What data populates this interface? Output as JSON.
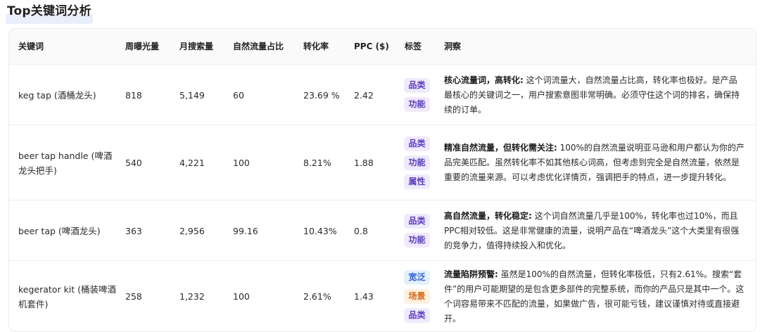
{
  "title": "Top关键词分析",
  "columns": {
    "keyword": "关键词",
    "impressions": "周曝光量",
    "searches": "月搜索量",
    "organic": "自然流量占比",
    "cvr": "转化率",
    "ppc": "PPC ($)",
    "tags": "标签",
    "insight": "洞察"
  },
  "colors": {
    "tag_purple_bg": "#efeafe",
    "tag_purple_fg": "#5b3cc4",
    "tag_blue_bg": "#e5efff",
    "tag_blue_fg": "#2b63d9",
    "tag_orange_bg": "#fff0e0",
    "tag_orange_fg": "#d6670f"
  },
  "rows": [
    {
      "keyword": "keg tap (酒桶龙头)",
      "impressions": "818",
      "searches": "5,149",
      "organic": "60",
      "cvr": "23.69 %",
      "ppc": "2.42",
      "tags": [
        {
          "label": "品类",
          "color": "purple"
        },
        {
          "label": "功能",
          "color": "purple"
        }
      ],
      "insight_head": "核心流量词，高转化:",
      "insight_body": " 这个词流量大，自然流量占比高，转化率也极好。是产品最核心的关键词之一，用户搜索意图非常明确。必须守住这个词的排名，确保持续的订单。"
    },
    {
      "keyword": "beer tap handle (啤酒龙头把手)",
      "impressions": "540",
      "searches": "4,221",
      "organic": "100",
      "cvr": "8.21%",
      "ppc": "1.88",
      "tags": [
        {
          "label": "品类",
          "color": "purple"
        },
        {
          "label": "功能",
          "color": "purple"
        },
        {
          "label": "属性",
          "color": "purple"
        }
      ],
      "insight_head": "精准自然流量，但转化需关注:",
      "insight_body": " 100%的自然流量说明亚马逊和用户都认为你的产品完美匹配。虽然转化率不如其他核心词高，但考虑到完全是自然流量，依然是重要的流量来源。可以考虑优化详情页，强调把手的特点，进一步提升转化。"
    },
    {
      "keyword": "beer tap (啤酒龙头)",
      "impressions": "363",
      "searches": "2,956",
      "organic": "99.16",
      "cvr": "10.43%",
      "ppc": "0.8",
      "tags": [
        {
          "label": "品类",
          "color": "purple"
        },
        {
          "label": "功能",
          "color": "purple"
        }
      ],
      "insight_head": "高自然流量，转化稳定:",
      "insight_body": " 这个词自然流量几乎是100%，转化率也过10%，而且PPC相对较低。这是非常健康的流量，说明产品在“啤酒龙头”这个大类里有很强的竞争力，值得持续投入和优化。"
    },
    {
      "keyword": "kegerator kit (桶装啤酒机套件)",
      "impressions": "258",
      "searches": "1,232",
      "organic": "100",
      "cvr": "2.61%",
      "ppc": "1.43",
      "tags": [
        {
          "label": "宽泛",
          "color": "blue"
        },
        {
          "label": "场景",
          "color": "orange"
        },
        {
          "label": "品类",
          "color": "purple"
        }
      ],
      "insight_head": "流量陷阱预警:",
      "insight_body": " 虽然是100%的自然流量，但转化率极低，只有2.61%。搜索“套件”的用户可能期望的是包含更多部件的完整系统，而你的产品只是其中一个。这个词容易带来不匹配的流量，如果做广告，很可能亏钱，建议谨慎对待或直接避开。"
    }
  ]
}
